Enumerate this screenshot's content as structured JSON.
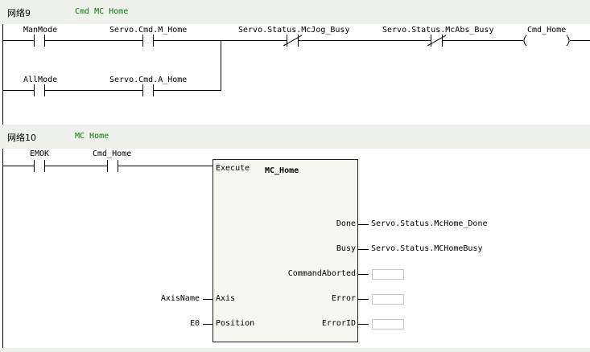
{
  "network9": {
    "number": "网络9",
    "comment": "Cmd MC Home",
    "contacts": {
      "manmode": "ManMode",
      "servo_cmd_m_home": "Servo.Cmd.M_Home",
      "servo_status_mcjog_busy": "Servo.Status.McJog_Busy",
      "servo_status_mcabs_busy": "Servo.Status.McAbs_Busy",
      "allmode": "AllMode",
      "servo_cmd_a_home": "Servo.Cmd.A_Home"
    },
    "coil": "Cmd_Home"
  },
  "network10": {
    "number": "网络10",
    "comment": "MC Home",
    "contacts": {
      "emok": "EMOK",
      "cmd_home": "Cmd_Home"
    },
    "block": {
      "title": "MC_Home",
      "inputs": {
        "execute": "Execute",
        "axis": "Axis",
        "position": "Position"
      },
      "outputs": {
        "done": "Done",
        "busy": "Busy",
        "command_aborted": "CommandAborted",
        "error": "Error",
        "error_id": "ErrorID"
      },
      "input_values": {
        "axis": "AxisName",
        "position": "E0"
      },
      "output_values": {
        "done": "Servo.Status.McHome_Done",
        "busy": "Servo.Status.MCHomeBusy",
        "command_aborted": "",
        "error": "",
        "error_id": ""
      }
    }
  }
}
